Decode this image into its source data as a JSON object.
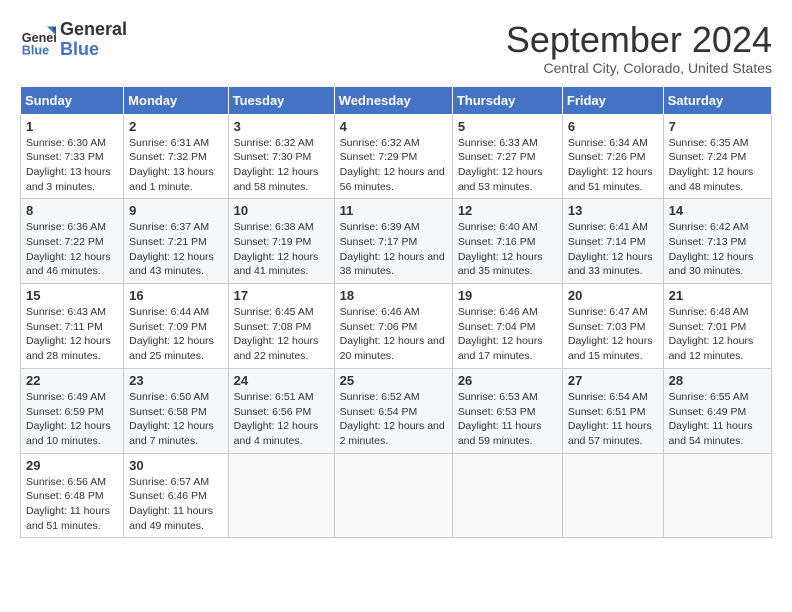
{
  "header": {
    "logo_line1": "General",
    "logo_line2": "Blue",
    "month_title": "September 2024",
    "location": "Central City, Colorado, United States"
  },
  "days_of_week": [
    "Sunday",
    "Monday",
    "Tuesday",
    "Wednesday",
    "Thursday",
    "Friday",
    "Saturday"
  ],
  "weeks": [
    [
      {
        "day": "1",
        "sunrise": "6:30 AM",
        "sunset": "7:33 PM",
        "daylight": "13 hours and 3 minutes."
      },
      {
        "day": "2",
        "sunrise": "6:31 AM",
        "sunset": "7:32 PM",
        "daylight": "13 hours and 1 minute."
      },
      {
        "day": "3",
        "sunrise": "6:32 AM",
        "sunset": "7:30 PM",
        "daylight": "12 hours and 58 minutes."
      },
      {
        "day": "4",
        "sunrise": "6:32 AM",
        "sunset": "7:29 PM",
        "daylight": "12 hours and 56 minutes."
      },
      {
        "day": "5",
        "sunrise": "6:33 AM",
        "sunset": "7:27 PM",
        "daylight": "12 hours and 53 minutes."
      },
      {
        "day": "6",
        "sunrise": "6:34 AM",
        "sunset": "7:26 PM",
        "daylight": "12 hours and 51 minutes."
      },
      {
        "day": "7",
        "sunrise": "6:35 AM",
        "sunset": "7:24 PM",
        "daylight": "12 hours and 48 minutes."
      }
    ],
    [
      {
        "day": "8",
        "sunrise": "6:36 AM",
        "sunset": "7:22 PM",
        "daylight": "12 hours and 46 minutes."
      },
      {
        "day": "9",
        "sunrise": "6:37 AM",
        "sunset": "7:21 PM",
        "daylight": "12 hours and 43 minutes."
      },
      {
        "day": "10",
        "sunrise": "6:38 AM",
        "sunset": "7:19 PM",
        "daylight": "12 hours and 41 minutes."
      },
      {
        "day": "11",
        "sunrise": "6:39 AM",
        "sunset": "7:17 PM",
        "daylight": "12 hours and 38 minutes."
      },
      {
        "day": "12",
        "sunrise": "6:40 AM",
        "sunset": "7:16 PM",
        "daylight": "12 hours and 35 minutes."
      },
      {
        "day": "13",
        "sunrise": "6:41 AM",
        "sunset": "7:14 PM",
        "daylight": "12 hours and 33 minutes."
      },
      {
        "day": "14",
        "sunrise": "6:42 AM",
        "sunset": "7:13 PM",
        "daylight": "12 hours and 30 minutes."
      }
    ],
    [
      {
        "day": "15",
        "sunrise": "6:43 AM",
        "sunset": "7:11 PM",
        "daylight": "12 hours and 28 minutes."
      },
      {
        "day": "16",
        "sunrise": "6:44 AM",
        "sunset": "7:09 PM",
        "daylight": "12 hours and 25 minutes."
      },
      {
        "day": "17",
        "sunrise": "6:45 AM",
        "sunset": "7:08 PM",
        "daylight": "12 hours and 22 minutes."
      },
      {
        "day": "18",
        "sunrise": "6:46 AM",
        "sunset": "7:06 PM",
        "daylight": "12 hours and 20 minutes."
      },
      {
        "day": "19",
        "sunrise": "6:46 AM",
        "sunset": "7:04 PM",
        "daylight": "12 hours and 17 minutes."
      },
      {
        "day": "20",
        "sunrise": "6:47 AM",
        "sunset": "7:03 PM",
        "daylight": "12 hours and 15 minutes."
      },
      {
        "day": "21",
        "sunrise": "6:48 AM",
        "sunset": "7:01 PM",
        "daylight": "12 hours and 12 minutes."
      }
    ],
    [
      {
        "day": "22",
        "sunrise": "6:49 AM",
        "sunset": "6:59 PM",
        "daylight": "12 hours and 10 minutes."
      },
      {
        "day": "23",
        "sunrise": "6:50 AM",
        "sunset": "6:58 PM",
        "daylight": "12 hours and 7 minutes."
      },
      {
        "day": "24",
        "sunrise": "6:51 AM",
        "sunset": "6:56 PM",
        "daylight": "12 hours and 4 minutes."
      },
      {
        "day": "25",
        "sunrise": "6:52 AM",
        "sunset": "6:54 PM",
        "daylight": "12 hours and 2 minutes."
      },
      {
        "day": "26",
        "sunrise": "6:53 AM",
        "sunset": "6:53 PM",
        "daylight": "11 hours and 59 minutes."
      },
      {
        "day": "27",
        "sunrise": "6:54 AM",
        "sunset": "6:51 PM",
        "daylight": "11 hours and 57 minutes."
      },
      {
        "day": "28",
        "sunrise": "6:55 AM",
        "sunset": "6:49 PM",
        "daylight": "11 hours and 54 minutes."
      }
    ],
    [
      {
        "day": "29",
        "sunrise": "6:56 AM",
        "sunset": "6:48 PM",
        "daylight": "11 hours and 51 minutes."
      },
      {
        "day": "30",
        "sunrise": "6:57 AM",
        "sunset": "6:46 PM",
        "daylight": "11 hours and 49 minutes."
      },
      null,
      null,
      null,
      null,
      null
    ]
  ]
}
